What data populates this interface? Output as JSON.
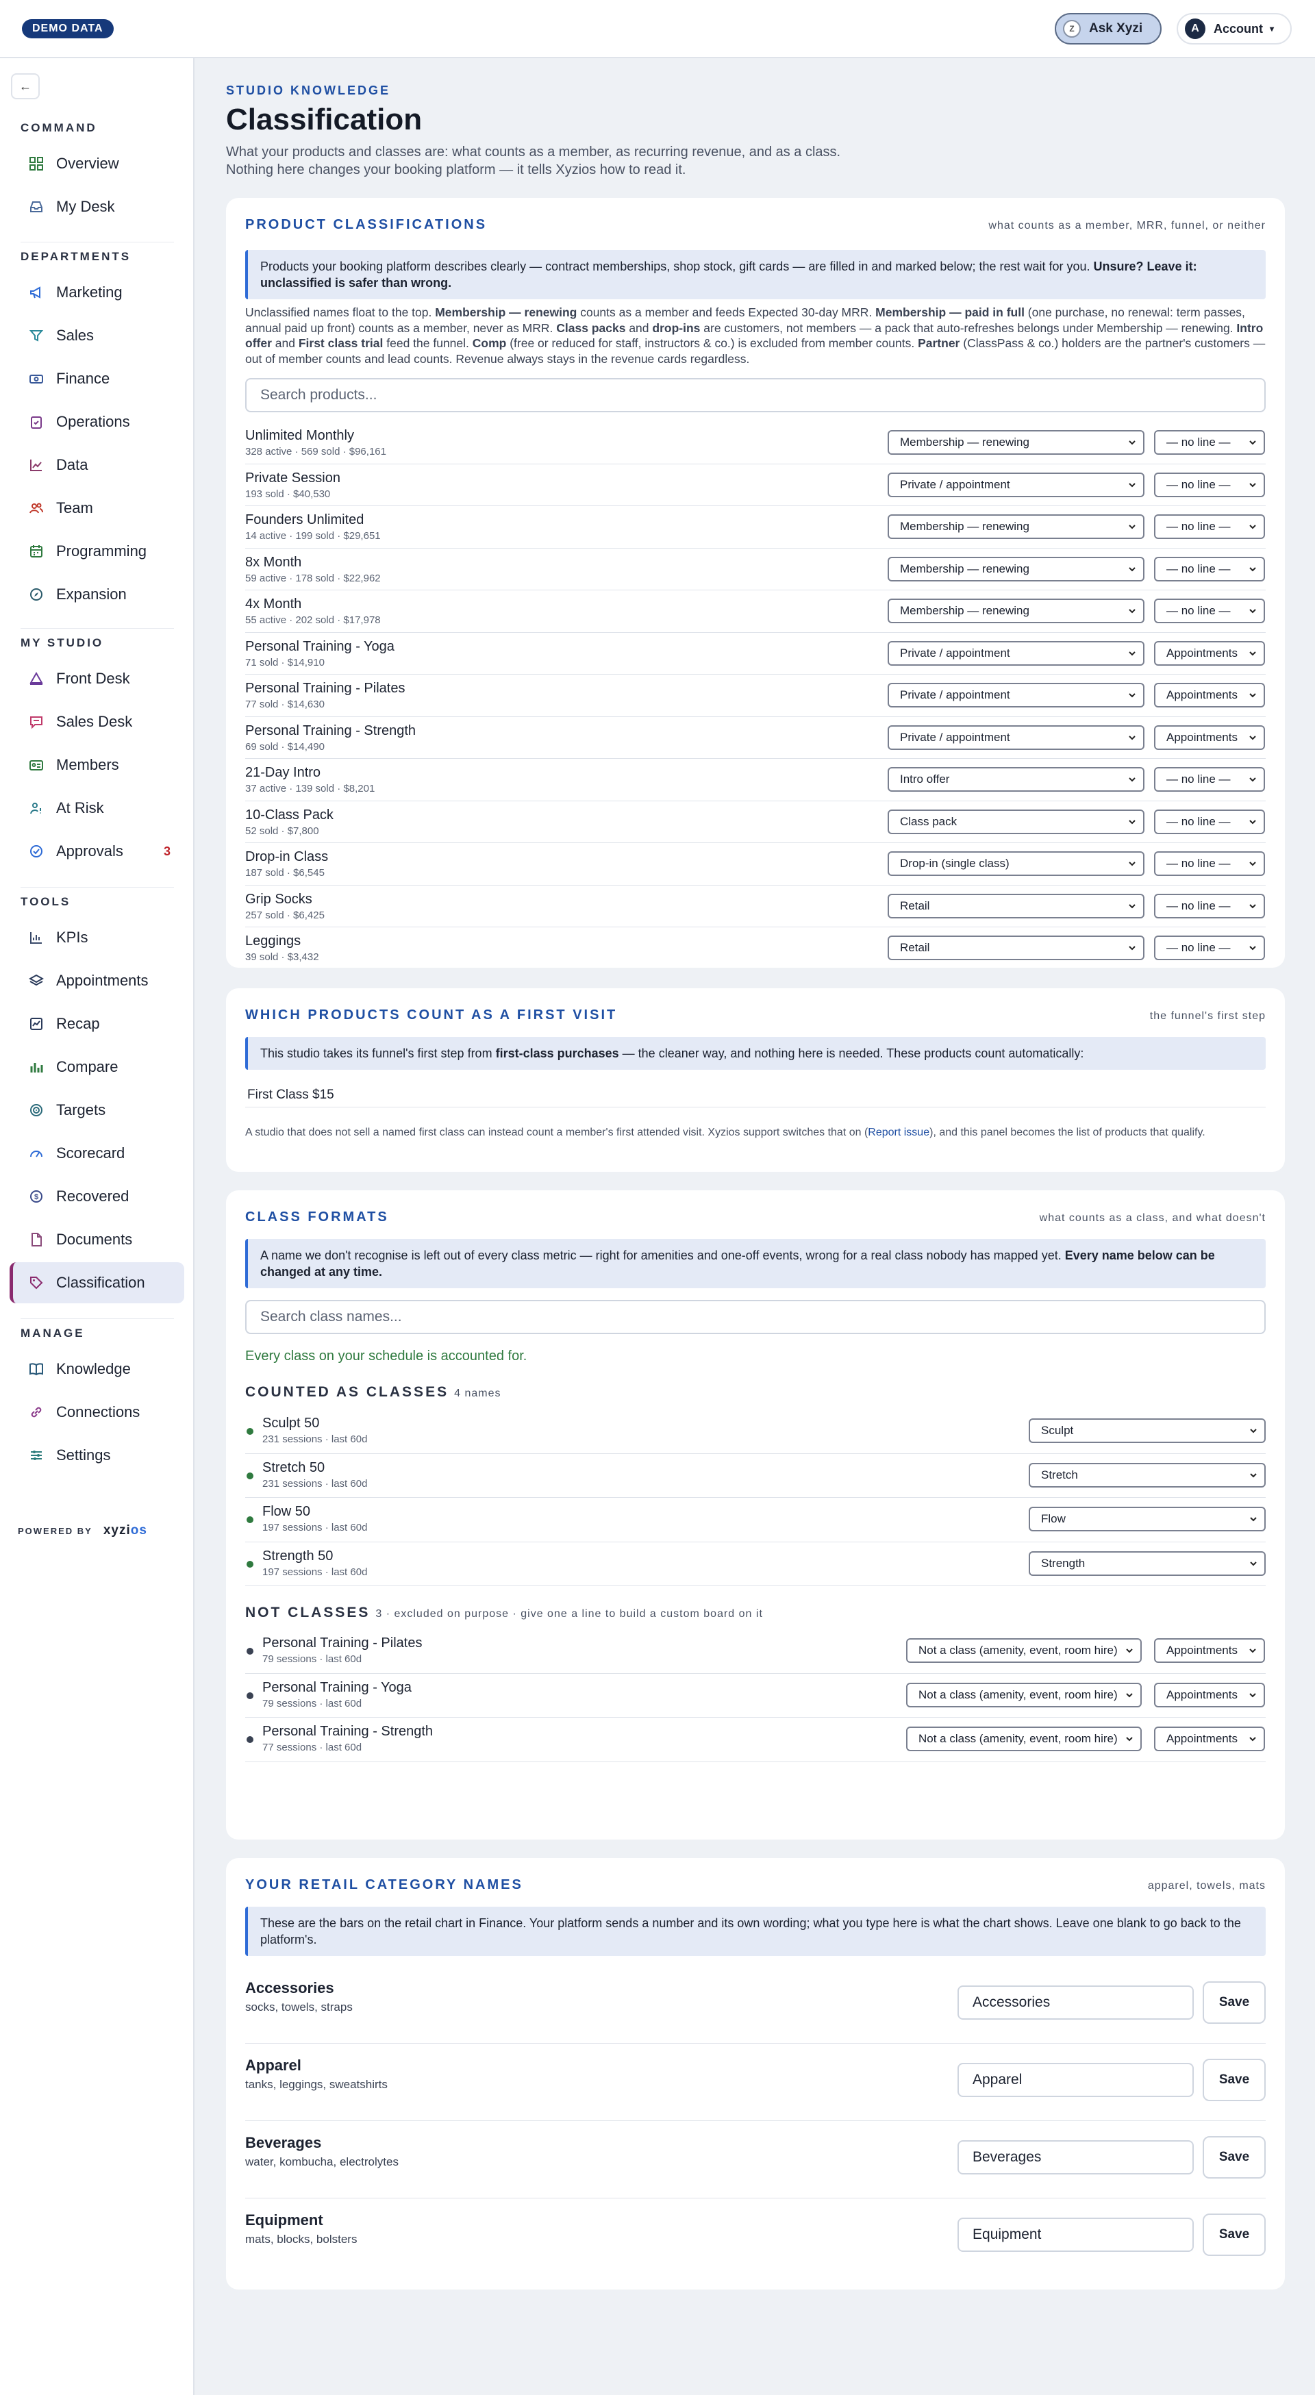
{
  "topbar": {
    "demo_badge": "DEMO DATA",
    "ask_label": "Ask Xyzi",
    "ask_icon": "Z",
    "account_label": "Account",
    "account_initial": "A"
  },
  "sidebar": {
    "sections": [
      {
        "label": "COMMAND",
        "items": [
          {
            "label": "Overview",
            "icon": "grid-icon"
          },
          {
            "label": "My Desk",
            "icon": "inbox-icon"
          }
        ]
      },
      {
        "label": "DEPARTMENTS",
        "items": [
          {
            "label": "Marketing",
            "icon": "megaphone-icon"
          },
          {
            "label": "Sales",
            "icon": "funnel-icon"
          },
          {
            "label": "Finance",
            "icon": "money-icon"
          },
          {
            "label": "Operations",
            "icon": "clipboard-icon"
          },
          {
            "label": "Data",
            "icon": "line-chart-icon"
          },
          {
            "label": "Team",
            "icon": "people-icon"
          },
          {
            "label": "Programming",
            "icon": "calendar-icon"
          },
          {
            "label": "Expansion",
            "icon": "compass-icon"
          }
        ]
      },
      {
        "label": "MY STUDIO",
        "items": [
          {
            "label": "Front Desk",
            "icon": "bell-icon"
          },
          {
            "label": "Sales Desk",
            "icon": "chat-icon"
          },
          {
            "label": "Members",
            "icon": "id-card-icon"
          },
          {
            "label": "At Risk",
            "icon": "user-alert-icon"
          },
          {
            "label": "Approvals",
            "icon": "check-circle-icon",
            "count": "3"
          }
        ]
      },
      {
        "label": "TOOLS",
        "items": [
          {
            "label": "KPIs",
            "icon": "kpi-icon"
          },
          {
            "label": "Appointments",
            "icon": "layers-icon"
          },
          {
            "label": "Recap",
            "icon": "recap-icon"
          },
          {
            "label": "Compare",
            "icon": "bar-chart-icon"
          },
          {
            "label": "Targets",
            "icon": "target-icon"
          },
          {
            "label": "Scorecard",
            "icon": "gauge-icon"
          },
          {
            "label": "Recovered",
            "icon": "dollar-circle-icon"
          },
          {
            "label": "Documents",
            "icon": "document-icon"
          },
          {
            "label": "Classification",
            "icon": "tag-icon",
            "active": true
          }
        ]
      },
      {
        "label": "MANAGE",
        "items": [
          {
            "label": "Knowledge",
            "icon": "book-icon"
          },
          {
            "label": "Connections",
            "icon": "link-icon"
          },
          {
            "label": "Settings",
            "icon": "sliders-icon"
          }
        ]
      }
    ],
    "powered_by": "POWERED BY",
    "logo_main": "xyzi",
    "logo_accent": "os"
  },
  "page": {
    "eyebrow": "STUDIO KNOWLEDGE",
    "title": "Classification",
    "intro_1": "What your products and classes are: what counts as a member, as recurring revenue, and as a class.",
    "intro_2": "Nothing here changes your booking platform — it tells Xyzios how to read it."
  },
  "products": {
    "title": "PRODUCT CLASSIFICATIONS",
    "note": "what counts as a member, MRR, funnel, or neither",
    "info_main": "Products your booking platform describes clearly — contract memberships, shop stock, gift cards — are filled in and marked below; the rest wait for you. ",
    "info_bold": "Unsure? Leave it: unclassified is safer than wrong.",
    "para": [
      {
        "t": "Unclassified names float to the top. "
      },
      {
        "b": "Membership — renewing"
      },
      {
        "t": " counts as a member and feeds Expected 30-day MRR. "
      },
      {
        "b": "Membership — paid in full"
      },
      {
        "t": " (one purchase, no renewal: term passes, annual paid up front) counts as a member, never as MRR. "
      },
      {
        "b": "Class packs"
      },
      {
        "t": " and "
      },
      {
        "b": "drop-ins"
      },
      {
        "t": " are customers, not members — a pack that auto-refreshes belongs under Membership — renewing. "
      },
      {
        "b": "Intro offer"
      },
      {
        "t": " and "
      },
      {
        "b": "First class trial"
      },
      {
        "t": " feed the funnel. "
      },
      {
        "b": "Comp"
      },
      {
        "t": " (free or reduced for staff, instructors & co.) is excluded from member counts. "
      },
      {
        "b": "Partner"
      },
      {
        "t": " (ClassPass & co.) holders are the partner's customers — out of member counts and lead counts. Revenue always stays in the revenue cards regardless."
      }
    ],
    "search_placeholder": "Search products...",
    "rows": [
      {
        "name": "Unlimited Monthly",
        "meta": "328 active · 569 sold · $96,161",
        "classification": "Membership — renewing",
        "line": "— no line —"
      },
      {
        "name": "Private Session",
        "meta": "193 sold · $40,530",
        "classification": "Private / appointment",
        "line": "— no line —"
      },
      {
        "name": "Founders Unlimited",
        "meta": "14 active · 199 sold · $29,651",
        "classification": "Membership — renewing",
        "line": "— no line —"
      },
      {
        "name": "8x Month",
        "meta": "59 active · 178 sold · $22,962",
        "classification": "Membership — renewing",
        "line": "— no line —"
      },
      {
        "name": "4x Month",
        "meta": "55 active · 202 sold · $17,978",
        "classification": "Membership — renewing",
        "line": "— no line —"
      },
      {
        "name": "Personal Training - Yoga",
        "meta": "71 sold · $14,910",
        "classification": "Private / appointment",
        "line": "Appointments"
      },
      {
        "name": "Personal Training - Pilates",
        "meta": "77 sold · $14,630",
        "classification": "Private / appointment",
        "line": "Appointments"
      },
      {
        "name": "Personal Training - Strength",
        "meta": "69 sold · $14,490",
        "classification": "Private / appointment",
        "line": "Appointments"
      },
      {
        "name": "21-Day Intro",
        "meta": "37 active · 139 sold · $8,201",
        "classification": "Intro offer",
        "line": "— no line —"
      },
      {
        "name": "10-Class Pack",
        "meta": "52 sold · $7,800",
        "classification": "Class pack",
        "line": "— no line —"
      },
      {
        "name": "Drop-in Class",
        "meta": "187 sold · $6,545",
        "classification": "Drop-in (single class)",
        "line": "— no line —"
      },
      {
        "name": "Grip Socks",
        "meta": "257 sold · $6,425",
        "classification": "Retail",
        "line": "— no line —"
      },
      {
        "name": "Leggings",
        "meta": "39 sold · $3,432",
        "classification": "Retail",
        "line": "— no line —"
      }
    ]
  },
  "first_visit": {
    "title": "WHICH PRODUCTS COUNT AS A FIRST VISIT",
    "note": "the funnel's first step",
    "info_pre": "This studio takes its funnel's first step from ",
    "info_bold": "first-class purchases",
    "info_post": " — the cleaner way, and nothing here is needed. These products count automatically:",
    "item": "First Class $15",
    "note_pre": "A studio that does not sell a named first class can instead count a member's first attended visit. Xyzios support switches that on (",
    "note_link": "Report issue",
    "note_post": "), and this panel becomes the list of products that qualify."
  },
  "class_formats": {
    "title": "CLASS FORMATS",
    "note": "what counts as a class, and what doesn't",
    "info_main": "A name we don't recognise is left out of every class metric — right for amenities and one-off events, wrong for a real class nobody has mapped yet. ",
    "info_bold": "Every name below can be changed at any time.",
    "search_placeholder": "Search class names...",
    "ok_message": "Every class on your schedule is accounted for.",
    "counted_title": "COUNTED AS CLASSES",
    "counted_sub": "4 names",
    "counted": [
      {
        "name": "Sculpt 50",
        "meta": "231 sessions · last 60d",
        "format": "Sculpt"
      },
      {
        "name": "Stretch 50",
        "meta": "231 sessions · last 60d",
        "format": "Stretch"
      },
      {
        "name": "Flow 50",
        "meta": "197 sessions · last 60d",
        "format": "Flow"
      },
      {
        "name": "Strength 50",
        "meta": "197 sessions · last 60d",
        "format": "Strength"
      }
    ],
    "not_title": "NOT CLASSES",
    "not_sub": "3 · excluded on purpose · give one a line to build a custom board on it",
    "not_classes": [
      {
        "name": "Personal Training - Pilates",
        "meta": "79 sessions · last 60d",
        "format": "Not a class (amenity, event, room hire)",
        "line": "Appointments"
      },
      {
        "name": "Personal Training - Yoga",
        "meta": "79 sessions · last 60d",
        "format": "Not a class (amenity, event, room hire)",
        "line": "Appointments"
      },
      {
        "name": "Personal Training - Strength",
        "meta": "77 sessions · last 60d",
        "format": "Not a class (amenity, event, room hire)",
        "line": "Appointments"
      }
    ]
  },
  "retail": {
    "title": "YOUR RETAIL CATEGORY NAMES",
    "note": "apparel, towels, mats",
    "info": "These are the bars on the retail chart in Finance. Your platform sends a number and its own wording; what you type here is what the chart shows. Leave one blank to go back to the platform's.",
    "save_label": "Save",
    "rows": [
      {
        "name": "Accessories",
        "meta": "socks, towels, straps",
        "value": "Accessories"
      },
      {
        "name": "Apparel",
        "meta": "tanks, leggings, sweatshirts",
        "value": "Apparel"
      },
      {
        "name": "Beverages",
        "meta": "water, kombucha, electrolytes",
        "value": "Beverages"
      },
      {
        "name": "Equipment",
        "meta": "mats, blocks, bolsters",
        "value": "Equipment"
      }
    ]
  }
}
